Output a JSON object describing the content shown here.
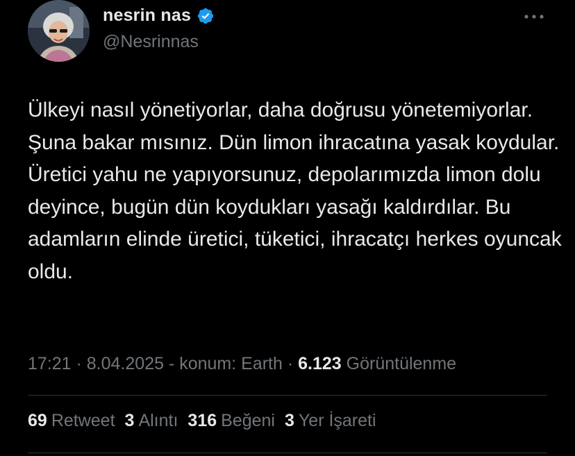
{
  "author": {
    "display_name": "nesrin nas",
    "handle": "@Nesrinnas",
    "verified_icon": "verified-badge-icon",
    "verified_color": "#1d9bf0"
  },
  "tweet": {
    "text": "Ülkeyi nasıl yönetiyorlar, daha doğrusu yönetemiyorlar. Şuna bakar mısınız. Dün limon ihracatına yasak koydular. Üretici yahu ne yapıyorsunuz, depolarımızda limon dolu deyince, bugün dün koydukları yasağı kaldırdılar. Bu adamların elinde üretici, tüketici, ihracatçı herkes oyuncak oldu."
  },
  "meta": {
    "time": "17:21",
    "sep1": " · ",
    "date": "8.04.2025",
    "location": " - konum: Earth",
    "sep2": " · ",
    "views_count": "6.123",
    "views_label": "Görüntülenme"
  },
  "stats": [
    {
      "count": "69",
      "label": "Retweet"
    },
    {
      "count": "3",
      "label": "Alıntı"
    },
    {
      "count": "316",
      "label": "Beğeni"
    },
    {
      "count": "3",
      "label": "Yer İşareti"
    }
  ],
  "colors": {
    "background": "#000000",
    "text": "#e7e9ea",
    "muted": "#71767b",
    "divider": "#2f3336"
  }
}
